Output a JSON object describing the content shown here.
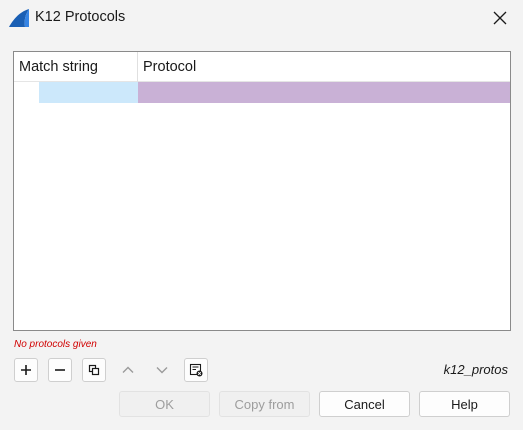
{
  "window": {
    "title": "K12 Protocols",
    "app_icon": "wireshark-fin-icon"
  },
  "table": {
    "columns": [
      "Match string",
      "Protocol"
    ],
    "rows": [
      {
        "match": "",
        "protocol": ""
      }
    ]
  },
  "status": {
    "error_text": "No protocols given",
    "error_color": "#d00000"
  },
  "toolbar": {
    "buttons": [
      {
        "name": "add",
        "icon": "plus-icon",
        "enabled": true
      },
      {
        "name": "remove",
        "icon": "minus-icon",
        "enabled": true
      },
      {
        "name": "copy",
        "icon": "copy-icon",
        "enabled": true
      },
      {
        "name": "move-up",
        "icon": "chevron-up-icon",
        "enabled": false
      },
      {
        "name": "move-down",
        "icon": "chevron-down-icon",
        "enabled": false
      },
      {
        "name": "clear",
        "icon": "clear-list-icon",
        "enabled": true
      }
    ],
    "filename": "k12_protos"
  },
  "buttons": {
    "ok": "OK",
    "copy_from": "Copy from",
    "cancel": "Cancel",
    "help": "Help"
  },
  "colors": {
    "match_cell": "#cce8fb",
    "protocol_cell": "#c9b1d6",
    "accent": "#1a5fb4"
  }
}
